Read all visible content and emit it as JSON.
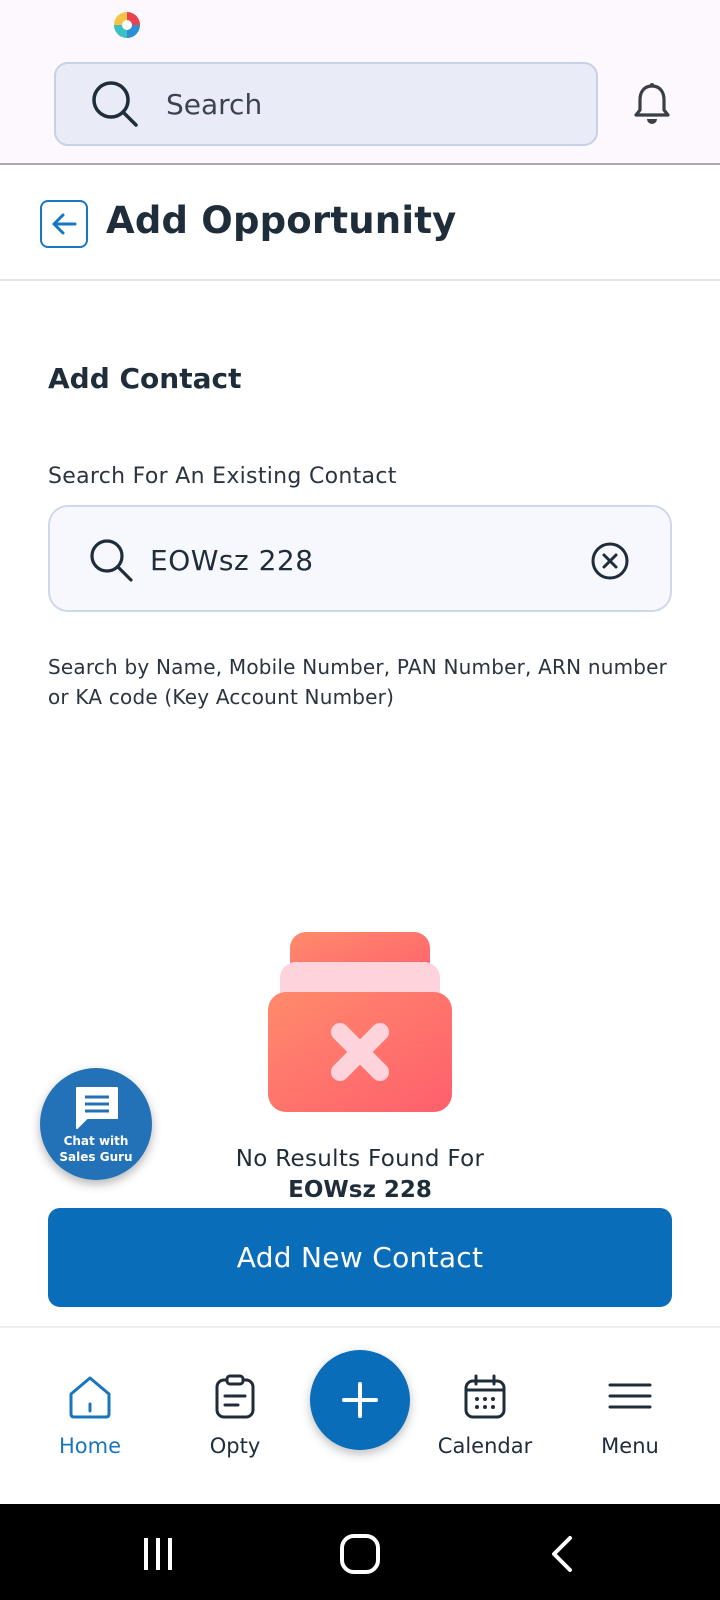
{
  "top_search": {
    "placeholder": "Search"
  },
  "header": {
    "title": "Add Opportunity"
  },
  "form": {
    "section_title": "Add Contact",
    "search_label": "Search For An Existing Contact",
    "search_value": "EOWsz 228",
    "helper_text": "Search by Name, Mobile Number, PAN Number, ARN number or KA code (Key Account Number)"
  },
  "empty_state": {
    "message": "No Results Found For",
    "query": "EOWsz 228"
  },
  "chat": {
    "line1": "Chat with",
    "line2": "Sales Guru"
  },
  "primary_button": {
    "label": "Add New Contact"
  },
  "bottom_nav": {
    "items": [
      {
        "label": "Home",
        "icon": "home-icon",
        "active": true
      },
      {
        "label": "Opty",
        "icon": "clipboard-icon",
        "active": false
      },
      {
        "label": "Calendar",
        "icon": "calendar-icon",
        "active": false
      },
      {
        "label": "Menu",
        "icon": "hamburger-icon",
        "active": false
      }
    ],
    "fab_icon": "plus-icon"
  },
  "colors": {
    "primary": "#0a6dba",
    "accent": "#1a75bd",
    "text": "#1f2d3a",
    "empty_red": "#ff6b6b"
  }
}
